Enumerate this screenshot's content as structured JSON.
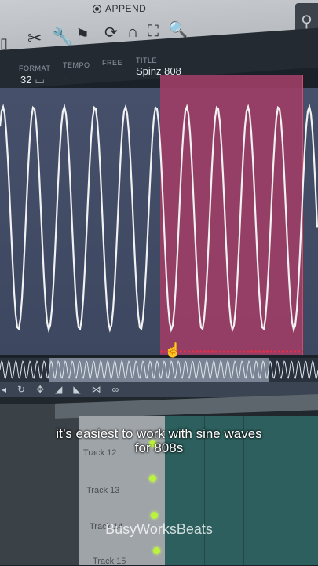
{
  "toolbar": {
    "append_label": "APPEND",
    "tools": [
      "cut-icon",
      "wrench-icon",
      "marker-icon",
      "loop-icon",
      "magnet-icon",
      "select-icon",
      "zoom-icon"
    ]
  },
  "info": {
    "format_label": "FORMAT",
    "format_value": "32",
    "tempo_label": "TEMPO",
    "tempo_value": "-",
    "free_label": "FREE",
    "title_label": "TITLE",
    "title_value": "Spinz 808"
  },
  "waveform": {
    "type": "sine",
    "selection_fraction": [
      0.5,
      0.95
    ],
    "colors": {
      "background": "#46506a",
      "selection": "#9c3e66",
      "line": "#f2f2f2"
    }
  },
  "playlist": {
    "tracks": [
      {
        "label": "Track 12"
      },
      {
        "label": "Track 13"
      },
      {
        "label": "Track 14"
      },
      {
        "label": "Track 15"
      }
    ]
  },
  "caption": {
    "line1": "it’s easiest to work with sine waves",
    "line2": "for 808s"
  },
  "watermark": "BusyWorksBeats"
}
